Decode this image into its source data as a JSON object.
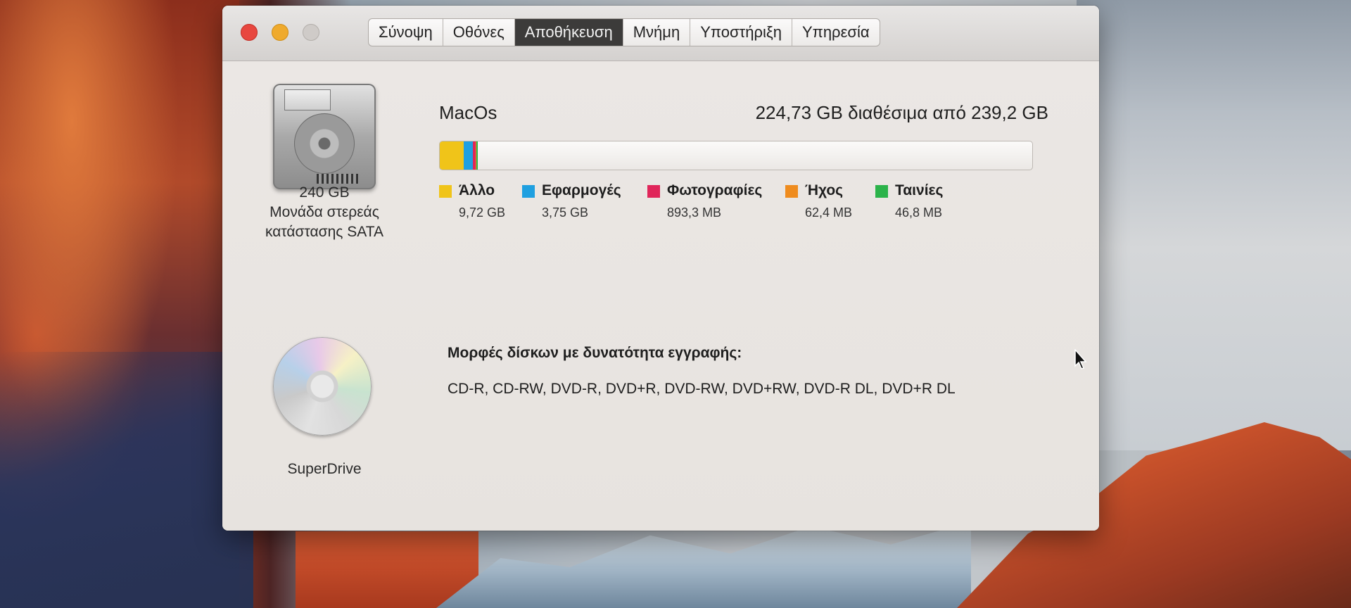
{
  "window": {
    "tabs": [
      {
        "label": "Σύνοψη",
        "active": false
      },
      {
        "label": "Οθόνες",
        "active": false
      },
      {
        "label": "Αποθήκευση",
        "active": true
      },
      {
        "label": "Μνήμη",
        "active": false
      },
      {
        "label": "Υποστήριξη",
        "active": false
      },
      {
        "label": "Υπηρεσία",
        "active": false
      }
    ]
  },
  "disk": {
    "capacity": "240 GB",
    "type_line1": "Μονάδα στερεάς",
    "type_line2": "κατάστασης SATA",
    "volume_name": "MacOs",
    "free_text": "224,73 GB διαθέσιμα από 239,2 GB",
    "categories": [
      {
        "label": "Άλλο",
        "size": "9,72 GB",
        "color": "#f0c419",
        "fraction": 0.0406
      },
      {
        "label": "Εφαρμογές",
        "size": "3,75 GB",
        "color": "#1fa0e0",
        "fraction": 0.0157
      },
      {
        "label": "Φωτογραφίες",
        "size": "893,3 MB",
        "color": "#e0265a",
        "fraction": 0.0037
      },
      {
        "label": "Ήχος",
        "size": "62,4 MB",
        "color": "#ef8c1e",
        "fraction": 0.0003
      },
      {
        "label": "Ταινίες",
        "size": "46,8 MB",
        "color": "#2bb34a",
        "fraction": 0.0002
      }
    ]
  },
  "optical": {
    "name": "SuperDrive",
    "formats_heading": "Μορφές δίσκων με δυνατότητα εγγραφής:",
    "formats": "CD-R, CD-RW, DVD-R, DVD+R, DVD-RW, DVD+RW, DVD-R DL, DVD+R DL"
  }
}
